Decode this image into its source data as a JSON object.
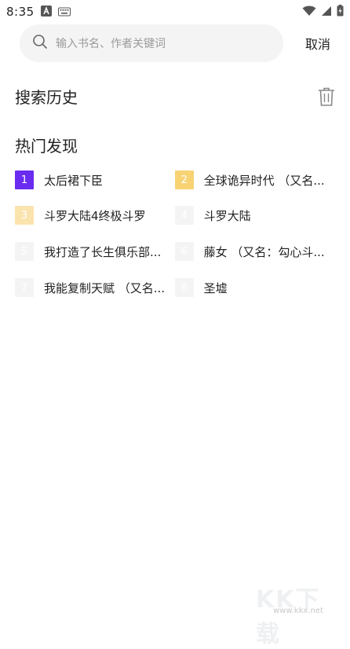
{
  "status_bar": {
    "time": "8:35",
    "left_icons": [
      "app-a-icon",
      "keyboard-icon"
    ],
    "right_icons": [
      "wifi-icon",
      "cellular-signal-icon",
      "battery-icon"
    ]
  },
  "search": {
    "placeholder": "输入书名、作者关键词",
    "cancel_label": "取消"
  },
  "history": {
    "title": "搜索历史"
  },
  "hot": {
    "title": "热门发现",
    "items": [
      {
        "rank": "1",
        "title": "太后裙下臣",
        "rank_color": "#6a2cf0"
      },
      {
        "rank": "2",
        "title": "全球诡异时代 （又名...",
        "rank_color": "#f8d374"
      },
      {
        "rank": "3",
        "title": "斗罗大陆4终极斗罗",
        "rank_color": "#fbe3ae"
      },
      {
        "rank": "4",
        "title": "斗罗大陆",
        "rank_color": "#f4f4f4"
      },
      {
        "rank": "5",
        "title": "我打造了长生俱乐部...",
        "rank_color": "#f4f4f4"
      },
      {
        "rank": "6",
        "title": "藤女 （又名：勾心斗...",
        "rank_color": "#f4f4f4"
      },
      {
        "rank": "7",
        "title": "我能复制天赋 （又名...",
        "rank_color": "#f4f4f4"
      },
      {
        "rank": "8",
        "title": "圣墟",
        "rank_color": "#f4f4f4"
      }
    ]
  },
  "watermark": {
    "text": "KK下载",
    "url": "www.kkx.net"
  }
}
